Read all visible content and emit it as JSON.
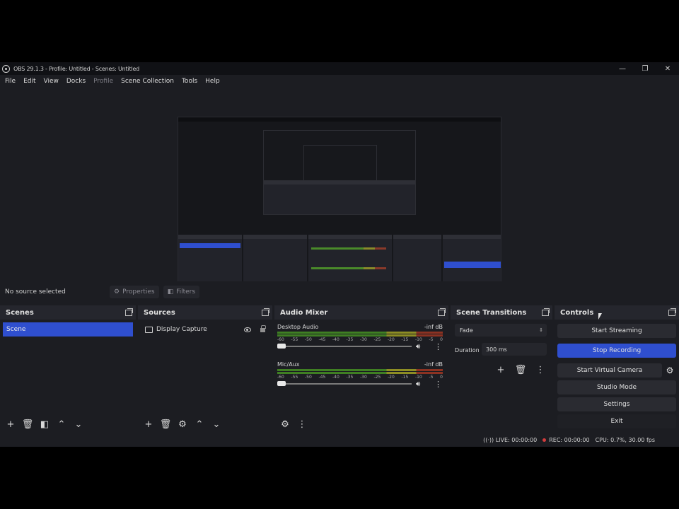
{
  "window": {
    "title": "OBS 29.1.3 - Profile: Untitled - Scenes: Untitled",
    "minimize": "—",
    "maximize": "❐",
    "close": "✕"
  },
  "menu": [
    "File",
    "Edit",
    "View",
    "Docks",
    "Profile",
    "Scene Collection",
    "Tools",
    "Help"
  ],
  "source_bar": {
    "no_source": "No source selected",
    "properties": "Properties",
    "filters": "Filters"
  },
  "scenes": {
    "title": "Scenes",
    "items": [
      "Scene"
    ]
  },
  "sources": {
    "title": "Sources",
    "items": [
      "Display Capture"
    ]
  },
  "mixer": {
    "title": "Audio Mixer",
    "channels": [
      {
        "name": "Desktop Audio",
        "db": "-inf dB",
        "level": 0.0
      },
      {
        "name": "Mic/Aux",
        "db": "-inf dB",
        "level": 0.0
      }
    ],
    "ticks": [
      "-60",
      "-55",
      "-50",
      "-45",
      "-40",
      "-35",
      "-30",
      "-25",
      "-20",
      "-15",
      "-10",
      "-5",
      "0"
    ]
  },
  "transitions": {
    "title": "Scene Transitions",
    "selected": "Fade",
    "duration_label": "Duration",
    "duration_value": "300 ms"
  },
  "controls": {
    "title": "Controls",
    "start_streaming": "Start Streaming",
    "stop_recording": "Stop Recording",
    "start_virtual_camera": "Start Virtual Camera",
    "studio_mode": "Studio Mode",
    "settings": "Settings",
    "exit": "Exit"
  },
  "status": {
    "live": "LIVE: 00:00:00",
    "rec": "REC: 00:00:00",
    "cpu": "CPU: 0.7%, 30.00 fps"
  },
  "colors": {
    "accent": "#2f4fcf",
    "background": "#1c1d22",
    "rec": "#d23c3c"
  }
}
